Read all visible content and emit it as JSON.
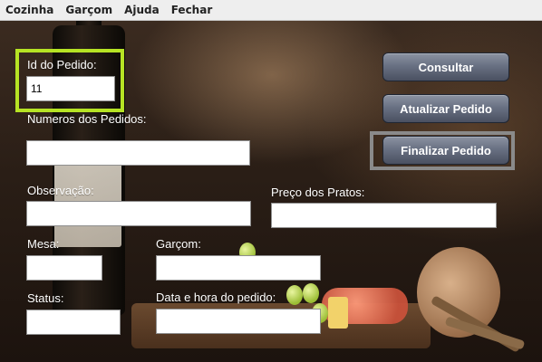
{
  "menu": {
    "items": [
      "Cozinha",
      "Garçom",
      "Ajuda",
      "Fechar"
    ]
  },
  "form": {
    "id_pedido": {
      "label": "Id do Pedido:",
      "value": "11"
    },
    "numeros_pedidos": {
      "label": "Numeros dos Pedidos:",
      "value": ""
    },
    "observacao": {
      "label": "Observação:",
      "value": ""
    },
    "preco_pratos": {
      "label": "Preço dos Pratos:",
      "value": ""
    },
    "mesa": {
      "label": "Mesa:",
      "value": ""
    },
    "garcom": {
      "label": "Garçom:",
      "value": ""
    },
    "status": {
      "label": "Status:",
      "value": ""
    },
    "data_hora": {
      "label": "Data e hora do pedido:",
      "value": ""
    }
  },
  "buttons": {
    "consultar": "Consultar",
    "atualizar": "Atualizar Pedido",
    "finalizar": "Finalizar Pedido"
  },
  "colors": {
    "focus_highlight": "#b6e324",
    "button_start": "#8c93a2",
    "button_end": "#4a5061"
  }
}
